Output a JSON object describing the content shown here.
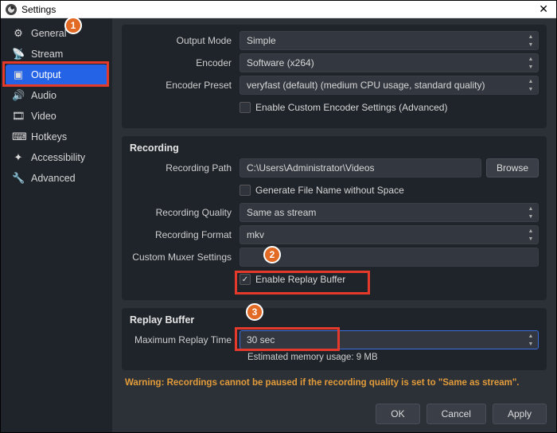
{
  "window": {
    "title": "Settings"
  },
  "sidebar": {
    "items": [
      {
        "label": "General"
      },
      {
        "label": "Stream"
      },
      {
        "label": "Output"
      },
      {
        "label": "Audio"
      },
      {
        "label": "Video"
      },
      {
        "label": "Hotkeys"
      },
      {
        "label": "Accessibility"
      },
      {
        "label": "Advanced"
      }
    ]
  },
  "streaming": {
    "output_mode_label": "Output Mode",
    "output_mode_value": "Simple",
    "encoder_label": "Encoder",
    "encoder_value": "Software (x264)",
    "preset_label": "Encoder Preset",
    "preset_value": "veryfast (default) (medium CPU usage, standard quality)",
    "custom_encoder_cb": "Enable Custom Encoder Settings (Advanced)"
  },
  "recording": {
    "section_title": "Recording",
    "path_label": "Recording Path",
    "path_value": "C:\\Users\\Administrator\\Videos",
    "browse": "Browse",
    "nospace_cb": "Generate File Name without Space",
    "quality_label": "Recording Quality",
    "quality_value": "Same as stream",
    "format_label": "Recording Format",
    "format_value": "mkv",
    "muxer_label": "Custom Muxer Settings",
    "muxer_value": "",
    "replay_cb": "Enable Replay Buffer"
  },
  "replay": {
    "section_title": "Replay Buffer",
    "max_label": "Maximum Replay Time",
    "max_value": "30 sec",
    "est_label": "Estimated memory usage: 9 MB"
  },
  "warning": "Warning: Recordings cannot be paused if the recording quality is set to \"Same as stream\".",
  "footer": {
    "ok": "OK",
    "cancel": "Cancel",
    "apply": "Apply"
  },
  "annotations": {
    "b1": "1",
    "b2": "2",
    "b3": "3"
  }
}
